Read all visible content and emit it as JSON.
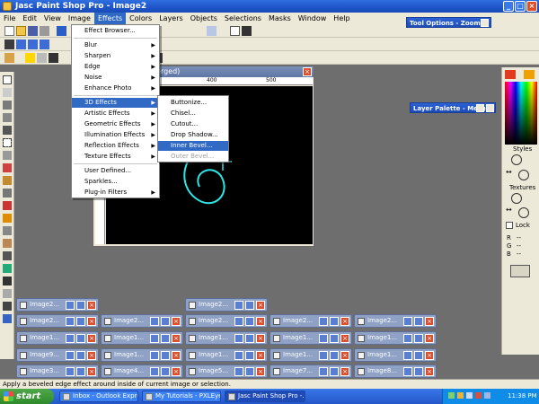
{
  "window": {
    "title": "Jasc Paint Shop Pro - Image2"
  },
  "menubar": [
    "File",
    "Edit",
    "View",
    "Image",
    "Effects",
    "Colors",
    "Layers",
    "Objects",
    "Selections",
    "Masks",
    "Window",
    "Help"
  ],
  "image_window": {
    "title_fragment": "erged)",
    "ruler_marks": [
      "400",
      "500"
    ]
  },
  "effects_menu": {
    "items": [
      {
        "label": "Effect Browser...",
        "arrow": false
      },
      {
        "label": "Blur",
        "arrow": true
      },
      {
        "label": "Sharpen",
        "arrow": true
      },
      {
        "label": "Edge",
        "arrow": true
      },
      {
        "label": "Noise",
        "arrow": true
      },
      {
        "label": "Enhance Photo",
        "arrow": true
      },
      {
        "label": "3D Effects",
        "arrow": true
      },
      {
        "label": "Artistic Effects",
        "arrow": true
      },
      {
        "label": "Geometric Effects",
        "arrow": true
      },
      {
        "label": "Illumination Effects",
        "arrow": true
      },
      {
        "label": "Reflection Effects",
        "arrow": true
      },
      {
        "label": "Texture Effects",
        "arrow": true
      },
      {
        "label": "User Defined...",
        "arrow": false
      },
      {
        "label": "Sparkles...",
        "arrow": false
      },
      {
        "label": "Plug-in Filters",
        "arrow": true
      }
    ]
  },
  "effects_3d_submenu": {
    "items": [
      "Buttonize...",
      "Chisel...",
      "Cutout...",
      "Drop Shadow...",
      "Inner Bevel...",
      "Outer Bevel..."
    ]
  },
  "tool_options": {
    "title": "Tool Options - Zoom"
  },
  "layer_palette": {
    "title": "Layer Palette - Merge"
  },
  "color_panel": {
    "styles": "Styles",
    "textures": "Textures",
    "lock": "Lock",
    "r": "R",
    "g": "G",
    "b": "B",
    "dash": "--"
  },
  "minimized_windows": {
    "row0": [
      "Image2...",
      "Image2..."
    ],
    "row1": [
      "Image2...",
      "Image2...",
      "Image2...",
      "Image2...",
      "Image2..."
    ],
    "row2": [
      "Image1...",
      "Image1...",
      "Image1...",
      "Image1...",
      "Image1..."
    ],
    "row3": [
      "Image9...",
      "Image1...",
      "Image1...",
      "Image1...",
      "Image1..."
    ],
    "row4": [
      "Image3...",
      "Image4...",
      "Image5...",
      "Image7...",
      "Image8..."
    ]
  },
  "statusbar": {
    "text": "Apply a beveled edge effect around inside of current image or selection."
  },
  "taskbar": {
    "start": "start",
    "tasks": [
      "Inbox - Outlook Express",
      "My Tutorials - PXLEye...",
      "Jasc Paint Shop Pro -..."
    ],
    "clock": "11:38 PM"
  },
  "colors": {
    "accent": "#316ac5",
    "titlebar": "#1f55c9",
    "canvas": "#000000",
    "cyan_stroke": "#2ee6e6"
  }
}
